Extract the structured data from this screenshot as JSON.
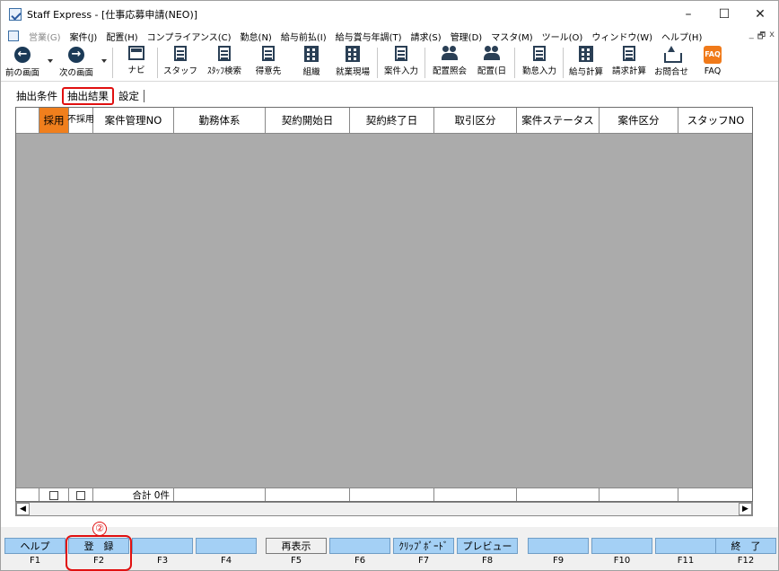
{
  "window": {
    "title": "Staff Express - [仕事応募申請(NEO)]",
    "controls": {
      "minimize": "–",
      "maximize": "☐",
      "close": "✕"
    }
  },
  "menu": {
    "items": [
      {
        "label": "営業(G)",
        "disabled": true
      },
      {
        "label": "案件(J)",
        "disabled": false
      },
      {
        "label": "配置(H)",
        "disabled": false
      },
      {
        "label": "コンプライアンス(C)",
        "disabled": false
      },
      {
        "label": "勤怠(N)",
        "disabled": false
      },
      {
        "label": "給与前払(I)",
        "disabled": false
      },
      {
        "label": "給与賞与年調(T)",
        "disabled": false
      },
      {
        "label": "請求(S)",
        "disabled": false
      },
      {
        "label": "管理(D)",
        "disabled": false
      },
      {
        "label": "マスタ(M)",
        "disabled": false
      },
      {
        "label": "ツール(O)",
        "disabled": false
      },
      {
        "label": "ウィンドウ(W)",
        "disabled": false
      },
      {
        "label": "ヘルプ(H)",
        "disabled": false
      }
    ],
    "mdi": {
      "minimize": "_",
      "restore": "🗗",
      "close": "x"
    }
  },
  "toolbar": {
    "back": "前の画面",
    "forward": "次の画面",
    "navi": "ナビ",
    "staff": "スタッフ",
    "staff_search": "ｽﾀｯﾌ検索",
    "client": "得意先",
    "organization": "組織",
    "worksite": "就業現場",
    "case_entry": "案件入力",
    "placement_inquiry": "配置照会",
    "placement_day": "配置(日",
    "attendance_entry": "勤怠入力",
    "payroll_calc": "給与計算",
    "billing_calc": "請求計算",
    "inquiry": "お問合せ",
    "faq": "FAQ",
    "faq_icon_text": "FAQ"
  },
  "tabs": [
    {
      "label": "抽出条件",
      "active": false
    },
    {
      "label": "抽出結果",
      "active": true
    },
    {
      "label": "設定",
      "active": false
    }
  ],
  "grid": {
    "columns": [
      "",
      "採用",
      "不採用",
      "案件管理NO",
      "勤務体系",
      "契約開始日",
      "契約終了日",
      "取引区分",
      "案件ステータス",
      "案件区分",
      "スタッフNO"
    ],
    "adopt_color": "#f07f1d",
    "rows": [],
    "footer_total": "合計 0件"
  },
  "annotation": {
    "marker": "②",
    "color": "#e01010"
  },
  "function_keys": [
    {
      "label": "ヘルプ",
      "key": "F1",
      "style": "blue"
    },
    {
      "label": "登　録",
      "key": "F2",
      "style": "blue",
      "highlight": true
    },
    {
      "label": "",
      "key": "F3",
      "style": "blue"
    },
    {
      "label": "",
      "key": "F4",
      "style": "blue"
    },
    {
      "label": "再表示",
      "key": "F5",
      "style": "plain"
    },
    {
      "label": "",
      "key": "F6",
      "style": "blue"
    },
    {
      "label": "ｸﾘｯﾌﾟﾎﾞｰﾄﾞ",
      "key": "F7",
      "style": "blue"
    },
    {
      "label": "プレビュー",
      "key": "F8",
      "style": "blue"
    },
    {
      "label": "",
      "key": "F9",
      "style": "blue"
    },
    {
      "label": "",
      "key": "F10",
      "style": "blue"
    },
    {
      "label": "",
      "key": "F11",
      "style": "blue"
    },
    {
      "label": "終　了",
      "key": "F12",
      "style": "blue"
    }
  ]
}
